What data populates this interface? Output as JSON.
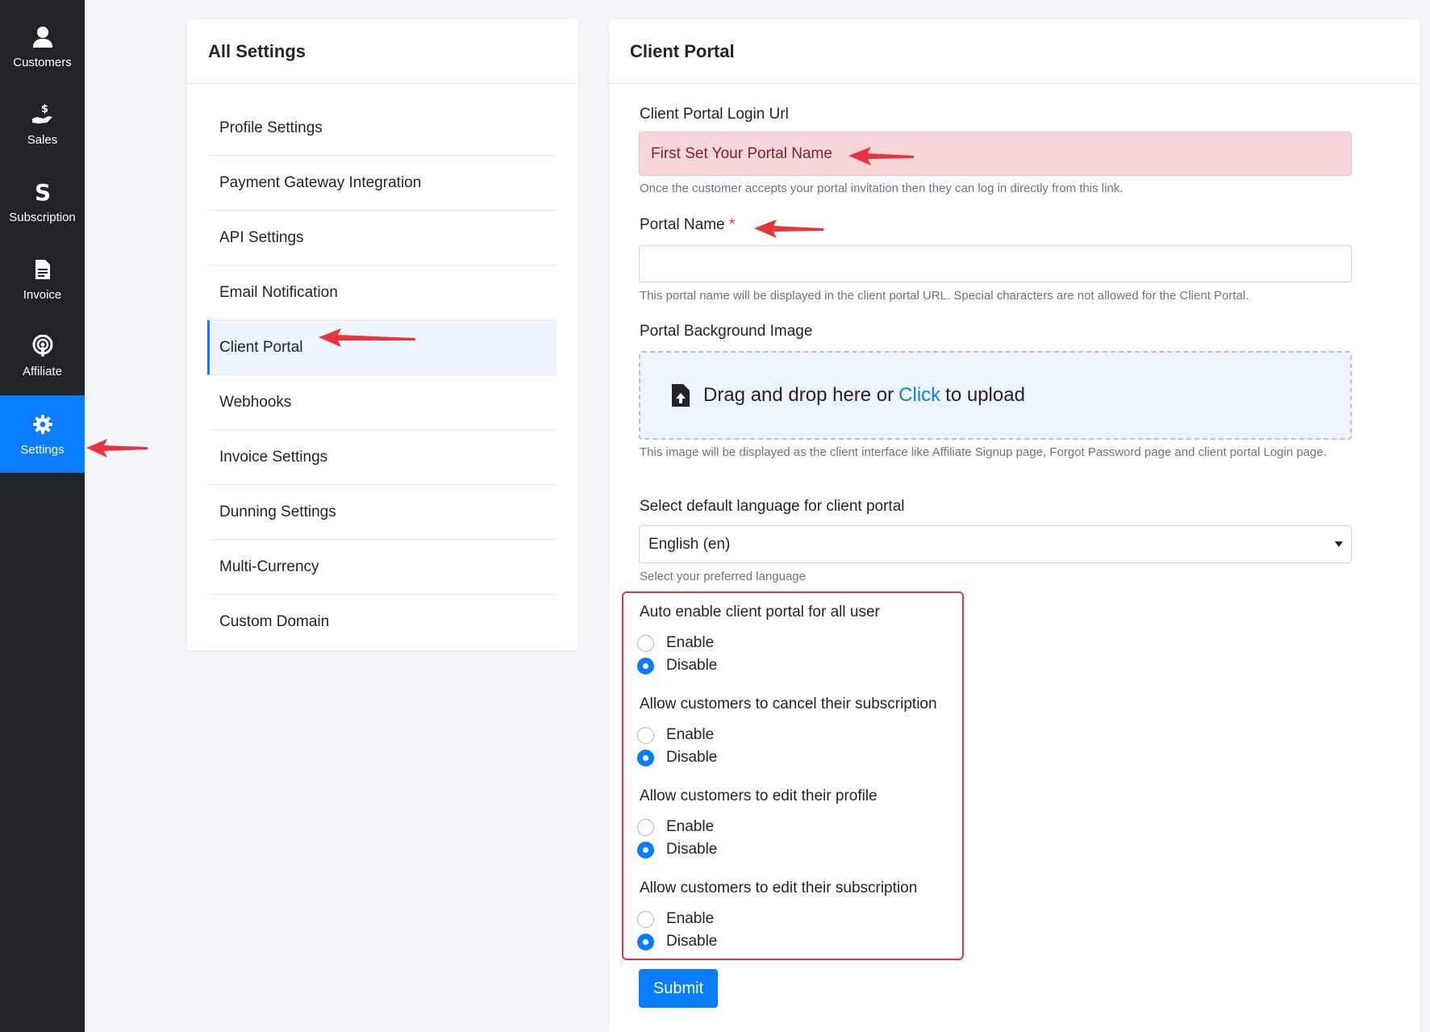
{
  "sidebar": {
    "items": [
      {
        "label": "Customers",
        "icon": "user-icon"
      },
      {
        "label": "Sales",
        "icon": "hand-dollar-icon"
      },
      {
        "label": "Subscription",
        "icon": "dollar-s-icon"
      },
      {
        "label": "Invoice",
        "icon": "document-icon"
      },
      {
        "label": "Affiliate",
        "icon": "podcast-icon"
      },
      {
        "label": "Settings",
        "icon": "gear-icon",
        "active": true
      }
    ],
    "active_color": "#0a7cff",
    "bg_color": "#1f2429"
  },
  "settings_menu": {
    "title": "All Settings",
    "items": [
      "Profile Settings",
      "Payment Gateway Integration",
      "API Settings",
      "Email Notification",
      "Client Portal",
      "Webhooks",
      "Invoice Settings",
      "Dunning Settings",
      "Multi-Currency",
      "Custom Domain"
    ],
    "active_item": "Client Portal"
  },
  "client_portal": {
    "title": "Client Portal",
    "login_url_label": "Client Portal Login Url",
    "login_url_alert": "First Set Your Portal Name",
    "login_url_help": "Once the customer accepts your portal invitation then they can log in directly from this link.",
    "portal_name_label": "Portal Name",
    "required_mark": "*",
    "portal_name_value": "",
    "portal_name_help": "This portal name will be displayed in the client portal URL. Special characters are not allowed for the Client Portal.",
    "bg_image_label": "Portal Background Image",
    "dropzone_text_before": "Drag and drop here or",
    "dropzone_link": "Click",
    "dropzone_text_after": "to upload",
    "bg_image_help": "This image will be displayed as the client interface like Affiliate Signup page, Forgot Password page and client portal Login page.",
    "language_label": "Select default language for client portal",
    "language_value": "English (en)",
    "language_help": "Select your preferred language",
    "options": [
      {
        "question": "Auto enable client portal for all user",
        "enable": "Enable",
        "disable": "Disable",
        "selected": "Disable"
      },
      {
        "question": "Allow customers to cancel their subscription",
        "enable": "Enable",
        "disable": "Disable",
        "selected": "Disable"
      },
      {
        "question": "Allow customers to edit their profile",
        "enable": "Enable",
        "disable": "Disable",
        "selected": "Disable"
      },
      {
        "question": "Allow customers to edit their subscription",
        "enable": "Enable",
        "disable": "Disable",
        "selected": "Disable"
      }
    ],
    "submit_label": "Submit"
  },
  "annotation_color": "#e8353d"
}
